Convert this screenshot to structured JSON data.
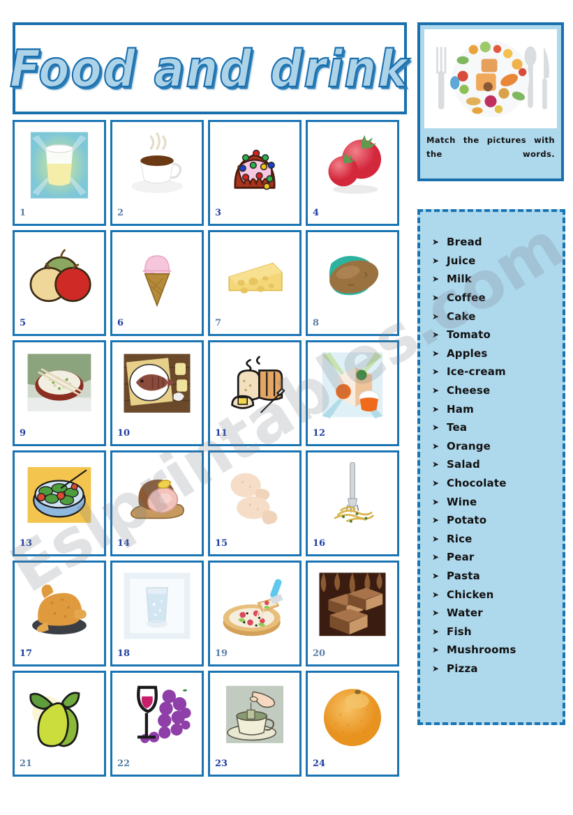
{
  "worksheet": {
    "title": "Food and drink",
    "instructions": "Match the pictures with the words.",
    "theme": {
      "border_blue": "#1A74B4",
      "panel_blue": "#AED8EC",
      "title_fill": "#ADD3E8",
      "number_blue": "#1F3FA0"
    },
    "watermark": "Eslprintables.com"
  },
  "instruction_image": {
    "name": "plate-of-food-collage",
    "description": "Round plate filled with assorted foods, with fork, spoon and knife"
  },
  "word_list": {
    "bullet": "➤",
    "items": [
      "Bread",
      "Juice",
      "Milk",
      "Coffee",
      "Cake",
      "Tomato",
      "Apples",
      "Ice-cream",
      "Cheese",
      "Ham",
      "Tea",
      "Orange",
      "Salad",
      "Chocolate",
      "Wine",
      "Potato",
      "Rice",
      "Pear",
      "Pasta",
      "Chicken",
      "Water",
      "Fish",
      "Mushrooms",
      "Pizza"
    ]
  },
  "pictures": [
    {
      "number": "1",
      "item": "glass-of-juice",
      "num_color": "gray"
    },
    {
      "number": "2",
      "item": "cup-of-coffee",
      "num_color": "gray"
    },
    {
      "number": "3",
      "item": "cake",
      "num_color": "blue"
    },
    {
      "number": "4",
      "item": "tomatoes",
      "num_color": "blue"
    },
    {
      "number": "5",
      "item": "apples",
      "num_color": "blue"
    },
    {
      "number": "6",
      "item": "ice-cream-cone",
      "num_color": "blue"
    },
    {
      "number": "7",
      "item": "cheese-wedge",
      "num_color": "gray"
    },
    {
      "number": "8",
      "item": "potato",
      "num_color": "gray"
    },
    {
      "number": "9",
      "item": "bowl-of-rice",
      "num_color": "blue"
    },
    {
      "number": "10",
      "item": "fish-on-plate",
      "num_color": "blue"
    },
    {
      "number": "11",
      "item": "loaf-of-bread",
      "num_color": "blue"
    },
    {
      "number": "12",
      "item": "orange-juice",
      "num_color": "blue"
    },
    {
      "number": "13",
      "item": "salad-bowl",
      "num_color": "blue"
    },
    {
      "number": "14",
      "item": "ham-on-board",
      "num_color": "blue"
    },
    {
      "number": "15",
      "item": "mushrooms",
      "num_color": "blue"
    },
    {
      "number": "16",
      "item": "pasta-with-fork",
      "num_color": "blue"
    },
    {
      "number": "17",
      "item": "roast-chicken",
      "num_color": "blue"
    },
    {
      "number": "18",
      "item": "glass-of-water",
      "num_color": "blue"
    },
    {
      "number": "19",
      "item": "pizza",
      "num_color": "gray"
    },
    {
      "number": "20",
      "item": "chocolate-bars",
      "num_color": "gray"
    },
    {
      "number": "21",
      "item": "pears",
      "num_color": "gray"
    },
    {
      "number": "22",
      "item": "wine-glass-and-grapes",
      "num_color": "gray"
    },
    {
      "number": "23",
      "item": "cup-of-tea",
      "num_color": "blue"
    },
    {
      "number": "24",
      "item": "orange",
      "num_color": "blue"
    }
  ]
}
